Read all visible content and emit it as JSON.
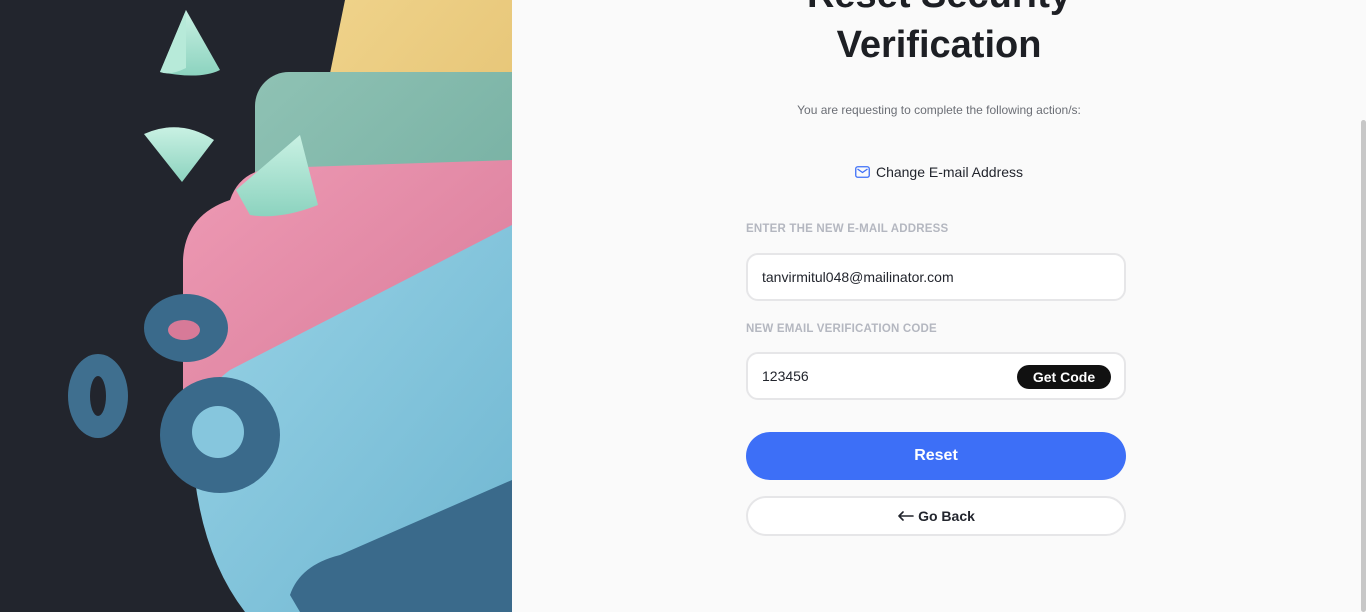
{
  "page": {
    "title_line1": "Reset Security",
    "title_line2": "Verification",
    "subtitle": "You are requesting to complete the following action/s:"
  },
  "action": {
    "icon": "mail-icon",
    "label": "Change E-mail Address"
  },
  "form": {
    "email": {
      "label": "ENTER THE NEW E-MAIL ADDRESS",
      "value": "tanvirmitul048@mailinator.com"
    },
    "code": {
      "label": "NEW EMAIL VERIFICATION CODE",
      "value": "123456",
      "get_code_label": "Get Code"
    },
    "reset_label": "Reset",
    "back_label": "Go Back",
    "back_icon": "arrow-left-icon"
  },
  "colors": {
    "accent": "#3d6ff7",
    "dark_panel": "#22252d",
    "get_code_bg": "#111111"
  }
}
